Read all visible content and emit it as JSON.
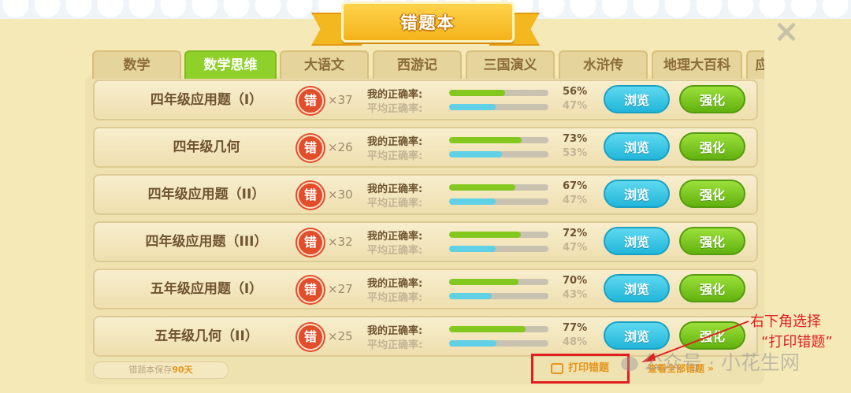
{
  "header": {
    "title": "错题本",
    "close_icon": "×"
  },
  "tabs": [
    "数学",
    "数学思维",
    "大语文",
    "西游记",
    "三国演义",
    "水浒传",
    "地理大百科",
    "应"
  ],
  "active_tab": "数学思维",
  "labels": {
    "my_rate": "我的正确率:",
    "avg_rate": "平均正确率:",
    "browse": "浏览",
    "strengthen": "强化",
    "stamp": "错"
  },
  "rows": [
    {
      "name": "四年级应用题（I）",
      "count": "×37",
      "my": "56%",
      "avg": "47%",
      "my_value": 0.56,
      "avg_value": 0.47
    },
    {
      "name": "四年级几何",
      "count": "×26",
      "my": "73%",
      "avg": "53%",
      "my_value": 0.73,
      "avg_value": 0.53
    },
    {
      "name": "四年级应用题（II）",
      "count": "×30",
      "my": "67%",
      "avg": "47%",
      "my_value": 0.67,
      "avg_value": 0.47
    },
    {
      "name": "四年级应用题（III）",
      "count": "×32",
      "my": "72%",
      "avg": "47%",
      "my_value": 0.72,
      "avg_value": 0.47
    },
    {
      "name": "五年级应用题（I）",
      "count": "×27",
      "my": "70%",
      "avg": "43%",
      "my_value": 0.7,
      "avg_value": 0.43
    },
    {
      "name": "五年级几何（II）",
      "count": "×25",
      "my": "77%",
      "avg": "48%",
      "my_value": 0.77,
      "avg_value": 0.48
    }
  ],
  "footer": {
    "save_prefix": "错题本保存",
    "save_days": "90天",
    "print": "打印错题",
    "view_all": "查看全部错题 »"
  },
  "annotation": {
    "line1": "右下角选择",
    "line2": "“打印错题”"
  },
  "watermark": "公众号 · 小花生网",
  "colors": {
    "accent_green": "#8fd12a",
    "browse_blue": "#21b6da",
    "annotation_red": "#e02020"
  }
}
